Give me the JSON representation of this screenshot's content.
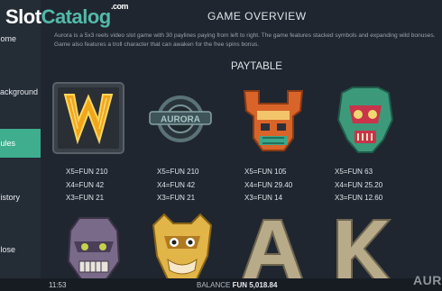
{
  "watermark": {
    "part1": "Slot",
    "part2": "Catalog",
    "part3": ".com"
  },
  "sidebar": {
    "items": [
      {
        "label": "Home",
        "active": false
      },
      {
        "label": "Background",
        "active": false
      },
      {
        "label": "Rules",
        "active": true
      },
      {
        "label": "History",
        "active": false
      },
      {
        "label": "Close",
        "active": false
      }
    ]
  },
  "page": {
    "title": "GAME OVERVIEW",
    "description": "Aurora is a 5x3 reels video slot game with 30 paylines paying from left to right. The game features stacked symbols and expanding wild bonuses. Game also features a troll character that can awaken for the free spins bonus.",
    "paytable_title": "PAYTABLE"
  },
  "symbols": [
    {
      "name": "golden-w-wild",
      "pays": [
        "X5=FUN 210",
        "X4=FUN 42",
        "X3=FUN 21"
      ]
    },
    {
      "name": "aurora-logo",
      "pays": [
        "X5=FUN 210",
        "X4=FUN 42",
        "X3=FUN 21"
      ]
    },
    {
      "name": "orange-tiki-mask",
      "pays": [
        "X5=FUN 105",
        "X4=FUN 29.40",
        "X3=FUN 14"
      ]
    },
    {
      "name": "green-tiki-mask",
      "pays": [
        "X5=FUN 63",
        "X4=FUN 25.20",
        "X3=FUN 12.60"
      ]
    },
    {
      "name": "purple-troll-head",
      "pays": []
    },
    {
      "name": "yellow-troll-head",
      "pays": []
    },
    {
      "name": "letter-a",
      "pays": []
    },
    {
      "name": "letter-k",
      "pays": []
    }
  ],
  "status": {
    "time": "11:53",
    "balance_label": "BALANCE",
    "balance_value": "FUN 5,018.84",
    "brand_logo": "AURO"
  },
  "colors": {
    "accent": "#3fae8e",
    "background": "#1f2630",
    "sidebar": "#242c36",
    "bottom_bar": "#171c23"
  }
}
